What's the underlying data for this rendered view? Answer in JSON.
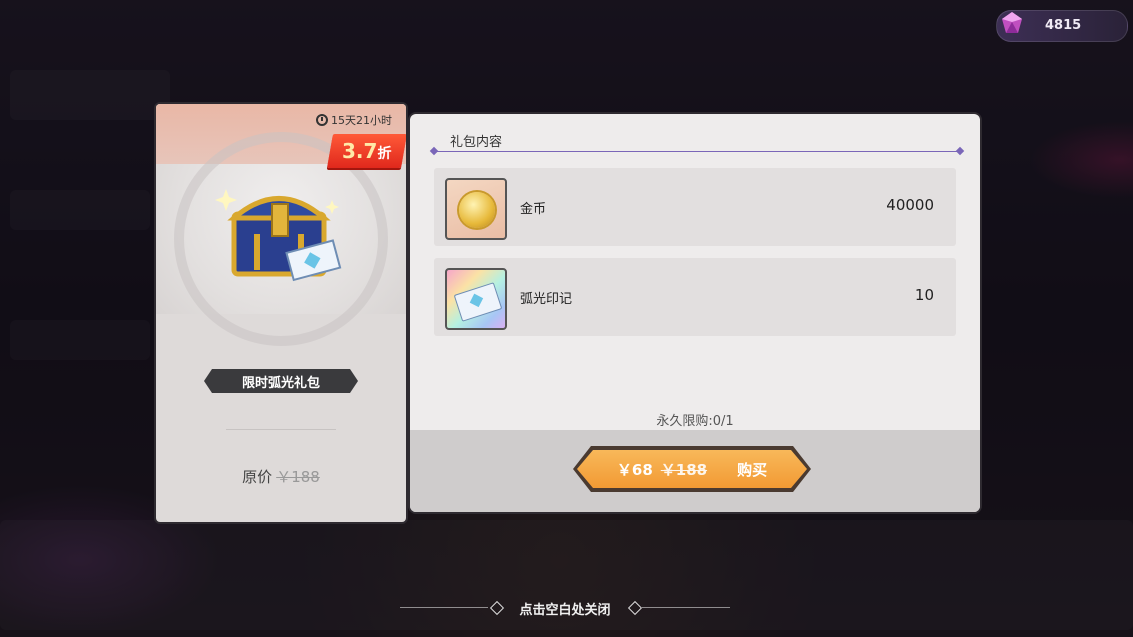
{
  "currency": {
    "amount": "4815",
    "icon": "gem-icon"
  },
  "pack": {
    "timer": "15天21小时",
    "discount_value": "3.7",
    "discount_unit": "折",
    "name": "限时弧光礼包",
    "original_label": "原价",
    "original_price": "￥188"
  },
  "contents": {
    "header": "礼包内容",
    "items": [
      {
        "name": "金币",
        "qty": "40000",
        "icon": "gold-coin-icon"
      },
      {
        "name": "弧光印记",
        "qty": "10",
        "icon": "arc-mark-ticket-icon"
      }
    ],
    "limit": "永久限购:0/1"
  },
  "buy": {
    "price": "￥68",
    "old_price": "￥188",
    "label": "购买"
  },
  "close_hint": "点击空白处关闭",
  "colors": {
    "accent": "#f29a34",
    "discount": "#e0281c",
    "line": "#7a66b8"
  }
}
